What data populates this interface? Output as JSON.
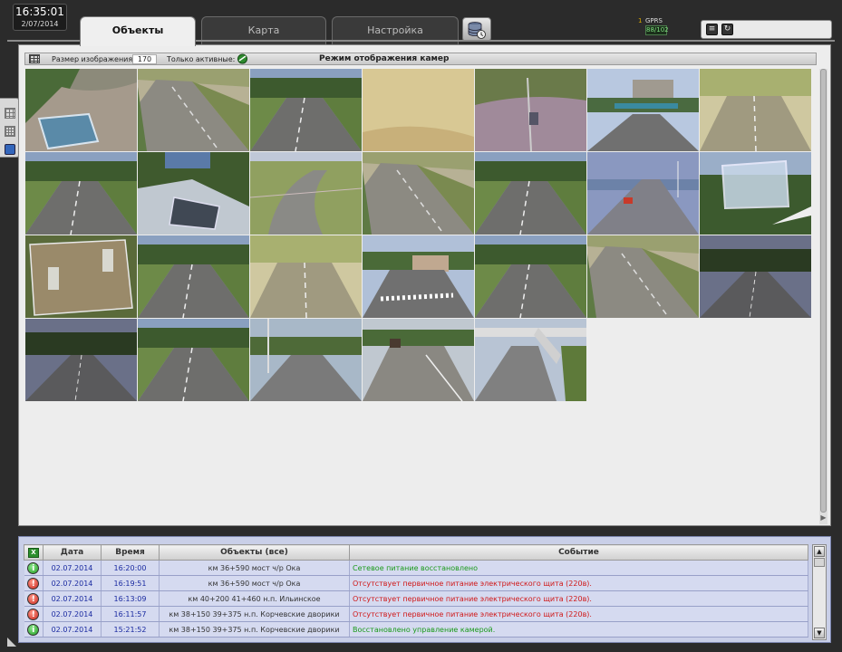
{
  "clock": {
    "time": "16:35:01",
    "date": "2/07/2014"
  },
  "tabs": [
    {
      "label": "Объекты",
      "active": true
    },
    {
      "label": "Карта",
      "active": false
    },
    {
      "label": "Настройка",
      "active": false
    }
  ],
  "gprs": {
    "count": "1",
    "label": "GPRS",
    "value": "88/102"
  },
  "toolbar": {
    "size_label": "Размер изображения:",
    "size_value": "170",
    "active_label": "Только активные:",
    "title": "Режим отображения камер"
  },
  "colors": {
    "ok": "#1a9a1a",
    "error": "#d01818",
    "date_blue": "#1a2aa0",
    "panel_bg": "#ededed",
    "events_bg": "#c9cfe8"
  },
  "cameras": [
    {
      "scene": "slope"
    },
    {
      "scene": "road-left"
    },
    {
      "scene": "road-trees"
    },
    {
      "scene": "foggy"
    },
    {
      "scene": "slope-pole"
    },
    {
      "scene": "bridge-city"
    },
    {
      "scene": "road-sunny"
    },
    {
      "scene": "road-trees"
    },
    {
      "scene": "box-closeup"
    },
    {
      "scene": "curve-road"
    },
    {
      "scene": "road-left"
    },
    {
      "scene": "road-trees"
    },
    {
      "scene": "river-bridge"
    },
    {
      "scene": "glass-box"
    },
    {
      "scene": "fenced-box"
    },
    {
      "scene": "road-trees"
    },
    {
      "scene": "road-sunny"
    },
    {
      "scene": "crosswalk-house"
    },
    {
      "scene": "road-trees"
    },
    {
      "scene": "road-left"
    },
    {
      "scene": "road-dark"
    },
    {
      "scene": "road-dark"
    },
    {
      "scene": "road-trees"
    },
    {
      "scene": "road-pole"
    },
    {
      "scene": "road-truck"
    },
    {
      "scene": "road-overpass"
    }
  ],
  "events": {
    "columns": [
      "Дата",
      "Время",
      "Объекты (все)",
      "Событие"
    ],
    "rows": [
      {
        "status": "ok",
        "date": "02.07.2014",
        "time": "16:20:00",
        "object": "км 36+590 мост ч/р Ока",
        "event": "Сетевое питание восстановлено"
      },
      {
        "status": "err",
        "date": "02.07.2014",
        "time": "16:19:51",
        "object": "км 36+590 мост ч/р Ока",
        "event": "Отсутствует первичное питание электрического щита (220в)."
      },
      {
        "status": "err",
        "date": "02.07.2014",
        "time": "16:13:09",
        "object": "км 40+200 41+460 н.п. Ильинское",
        "event": "Отсутствует первичное питание электрического щита (220в)."
      },
      {
        "status": "err",
        "date": "02.07.2014",
        "time": "16:11:57",
        "object": "км 38+150 39+375 н.п. Корчевские дворики",
        "event": "Отсутствует первичное питание электрического щита (220в)."
      },
      {
        "status": "ok",
        "date": "02.07.2014",
        "time": "15:21:52",
        "object": "км 38+150 39+375 н.п. Корчевские дворики",
        "event": "Восстановлено управление камерой."
      }
    ]
  }
}
